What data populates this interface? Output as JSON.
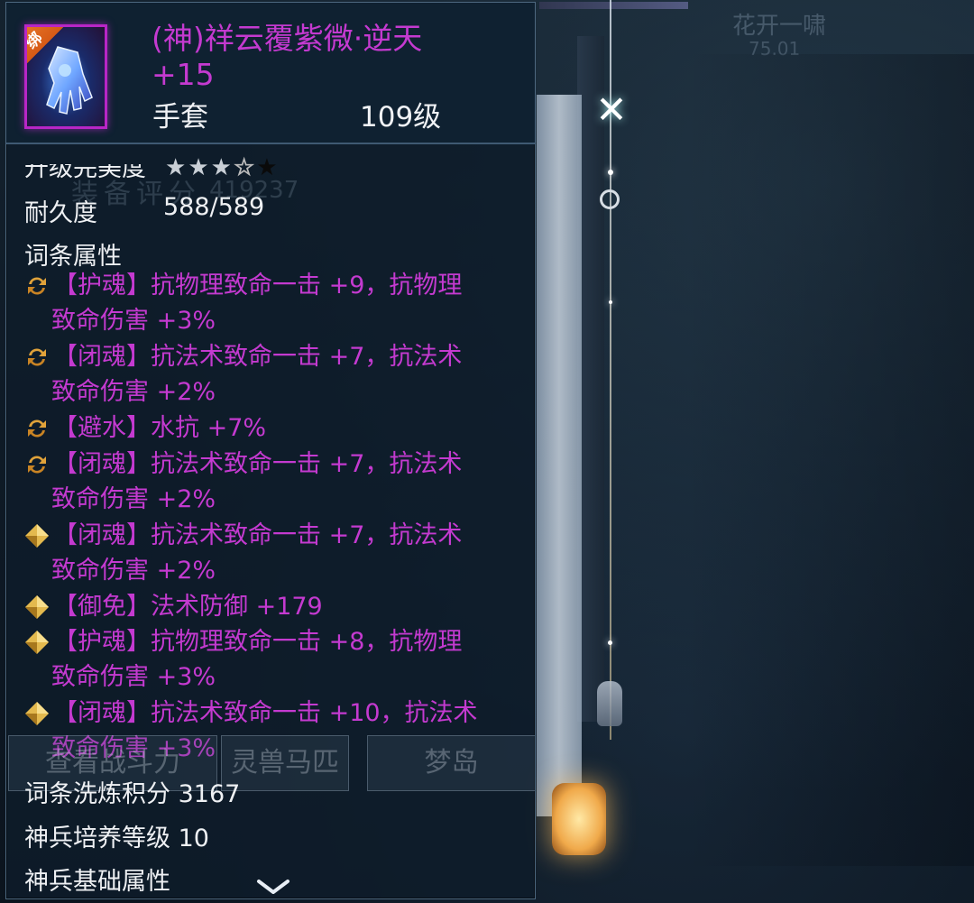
{
  "background": {
    "buttons": [
      "查看战斗力",
      "灵兽马匹",
      "梦岛"
    ],
    "player_name": "花开一啸",
    "player_sub": "75.01",
    "watermark": "装备评分",
    "watermark_value": "419237"
  },
  "item": {
    "bind_badge": "绑",
    "title": "(神)祥云覆紫微·逆天 +15",
    "type": "手套",
    "level": "109级",
    "perfection_label": "升级完美度",
    "stars": {
      "filled": 3,
      "empty": 1,
      "off": 1
    },
    "durability_label": "耐久度",
    "durability_value": "588/589",
    "affix_section_title": "词条属性",
    "affixes": [
      {
        "icon": "refresh-icon",
        "line1": "【护魂】抗物理致命一击 +9，抗物理",
        "line2": "致命伤害 +3%"
      },
      {
        "icon": "refresh-icon",
        "line1": "【闭魂】抗法术致命一击 +7，抗法术",
        "line2": "致命伤害 +2%"
      },
      {
        "icon": "refresh-icon",
        "line1": "【避水】水抗 +7%",
        "line2": ""
      },
      {
        "icon": "refresh-icon",
        "line1": "【闭魂】抗法术致命一击 +7，抗法术",
        "line2": "致命伤害 +2%"
      },
      {
        "icon": "diamond-icon",
        "line1": "【闭魂】抗法术致命一击 +7，抗法术",
        "line2": "致命伤害 +2%"
      },
      {
        "icon": "diamond-icon",
        "line1": "【御免】法术防御 +179",
        "line2": ""
      },
      {
        "icon": "diamond-icon",
        "line1": "【护魂】抗物理致命一击 +8，抗物理",
        "line2": "致命伤害 +3%"
      },
      {
        "icon": "diamond-icon",
        "line1": "【闭魂】抗法术致命一击 +10，抗法术",
        "line2": "致命伤害 +3%"
      }
    ],
    "refine_score_label": "词条洗炼积分",
    "refine_score_value": "3167",
    "god_weapon_level_label": "神兵培养等级",
    "god_weapon_level_value": "10",
    "god_weapon_base_label": "神兵基础属性"
  },
  "colors": {
    "affix_purple": "#c43ad0",
    "icon_border": "#b826c6",
    "bind_orange": "#e9792a",
    "text_white": "#eef0f3"
  }
}
